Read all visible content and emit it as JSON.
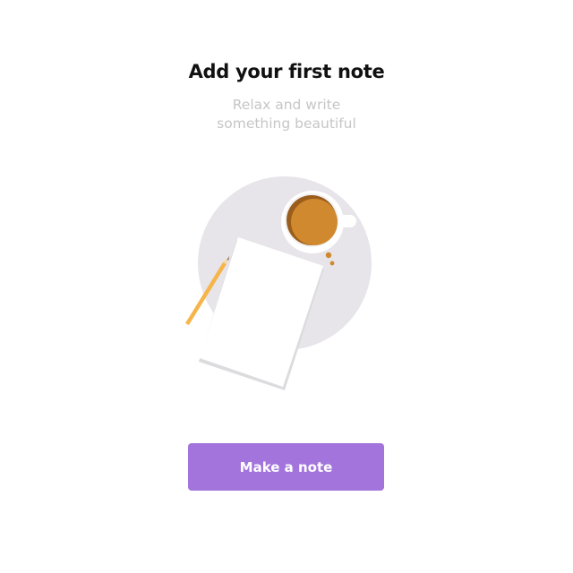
{
  "empty_state": {
    "title": "Add your first note",
    "subtitle_line1": "Relax and write",
    "subtitle_line2": "something beautiful",
    "illustration_icon": "coffee-and-paper-illustration"
  },
  "actions": {
    "primary_label": "Make a note"
  },
  "colors": {
    "accent": "#a374dc",
    "title": "#111111",
    "subtitle": "#c6c6c6",
    "backdrop": "#e7e5ea",
    "coffee": "#d0892f",
    "pencil": "#f6b54a"
  }
}
